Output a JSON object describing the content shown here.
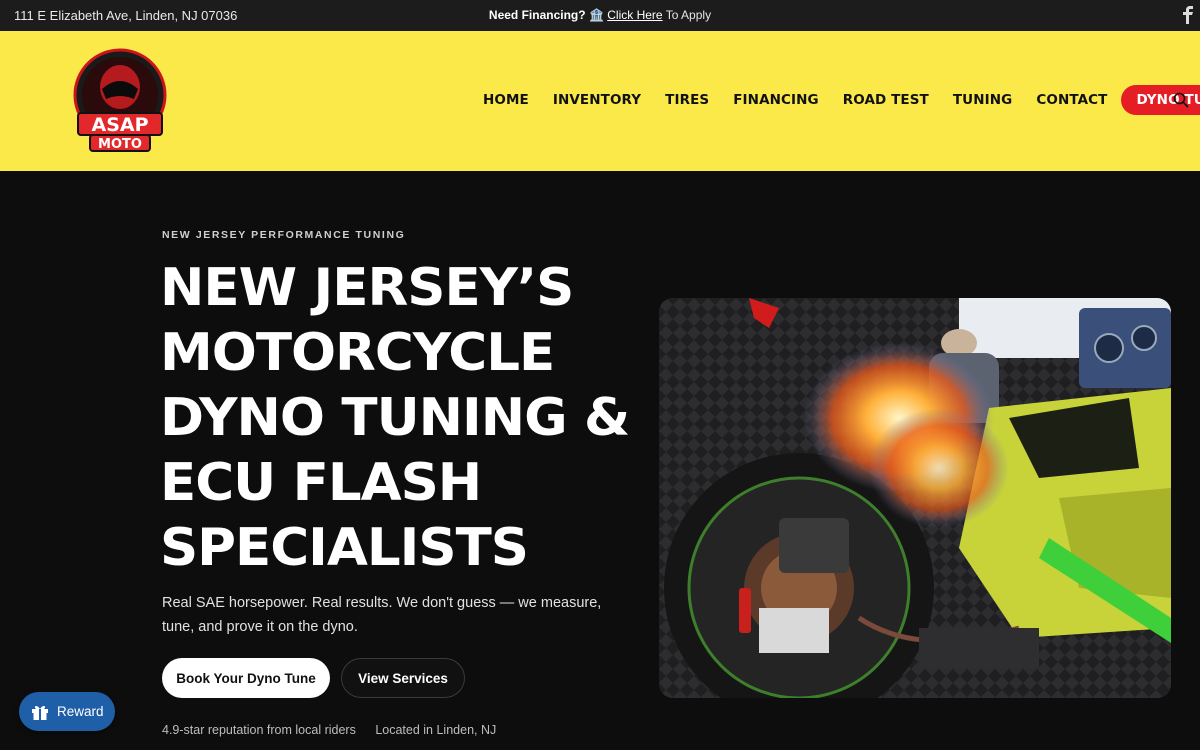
{
  "topbar": {
    "address": "111 E Elizabeth Ave, Linden, NJ 07036",
    "promo_bold": "Need Financing?",
    "promo_emoji": "🏦",
    "promo_link": "Click Here",
    "promo_tail": "To Apply",
    "social_icon": "facebook-icon"
  },
  "header": {
    "logo_line1": "ASAP",
    "logo_line2": "MOTO",
    "nav": [
      {
        "label": "HOME"
      },
      {
        "label": "INVENTORY"
      },
      {
        "label": "TIRES"
      },
      {
        "label": "FINANCING"
      },
      {
        "label": "ROAD TEST"
      },
      {
        "label": "TUNING"
      },
      {
        "label": "CONTACT"
      }
    ],
    "cta_label": "DYNO TUNE",
    "colors": {
      "background": "#fbe94a",
      "cta": "#e51d24"
    }
  },
  "hero": {
    "eyebrow": "NEW JERSEY PERFORMANCE TUNING",
    "headline": "NEW JERSEY’S MOTORCYCLE DYNO TUNING & ECU FLASH SPECIALISTS",
    "subtext": "Real SAE horsepower. Real results. We don't guess — we measure, tune, and prove it on the dyno.",
    "primary_button": "Book Your Dyno Tune",
    "secondary_button": "View Services",
    "trust_rating": "4.9-star reputation from local riders",
    "trust_location": "Located in Linden, NJ"
  },
  "reward": {
    "label": "Reward",
    "color": "#1e5fa8"
  }
}
